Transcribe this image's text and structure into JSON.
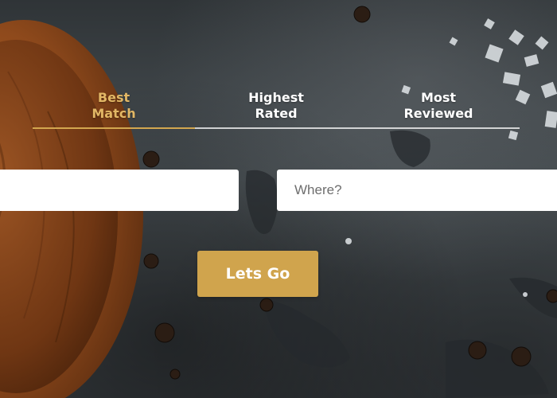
{
  "tabs": [
    {
      "label": "Best\nMatch",
      "active": true
    },
    {
      "label": "Highest\nRated",
      "active": false
    },
    {
      "label": "Most\nReviewed",
      "active": false
    }
  ],
  "search": {
    "what_value": "",
    "where_placeholder": "Where?"
  },
  "submit": {
    "label": "Lets Go"
  },
  "colors": {
    "accent": "#d0a44d",
    "active_tab_text": "#e2b765",
    "slate_background": "#3f4448",
    "wood": "#8a4a1e"
  }
}
